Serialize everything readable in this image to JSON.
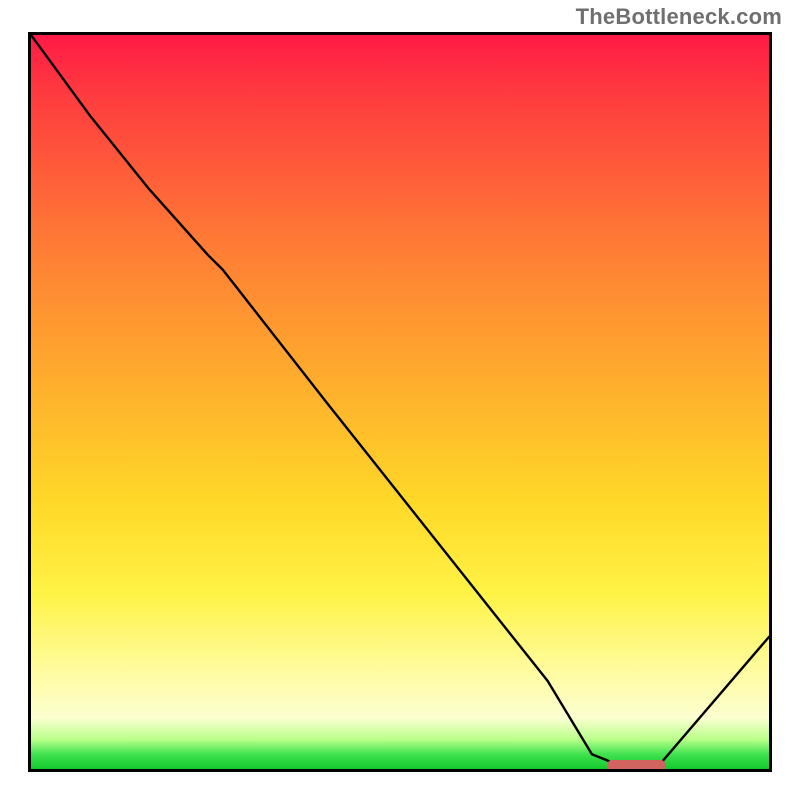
{
  "watermark": "TheBottleneck.com",
  "colors": {
    "gradient_top": "#ff1a46",
    "gradient_bottom": "#14c92e",
    "curve": "#000000",
    "marker": "#d1645f",
    "frame": "#000000"
  },
  "chart_data": {
    "type": "line",
    "title": "",
    "xlabel": "",
    "ylabel": "",
    "xlim": [
      0,
      100
    ],
    "ylim": [
      0,
      100
    ],
    "x": [
      0,
      8,
      16,
      24,
      26,
      40,
      55,
      70,
      76,
      80,
      85,
      100
    ],
    "values": [
      100,
      89,
      79,
      70,
      68,
      50,
      31,
      12,
      2,
      0.4,
      0.4,
      18
    ],
    "marker": {
      "x_start": 78,
      "x_end": 86,
      "y": 0.6
    }
  }
}
